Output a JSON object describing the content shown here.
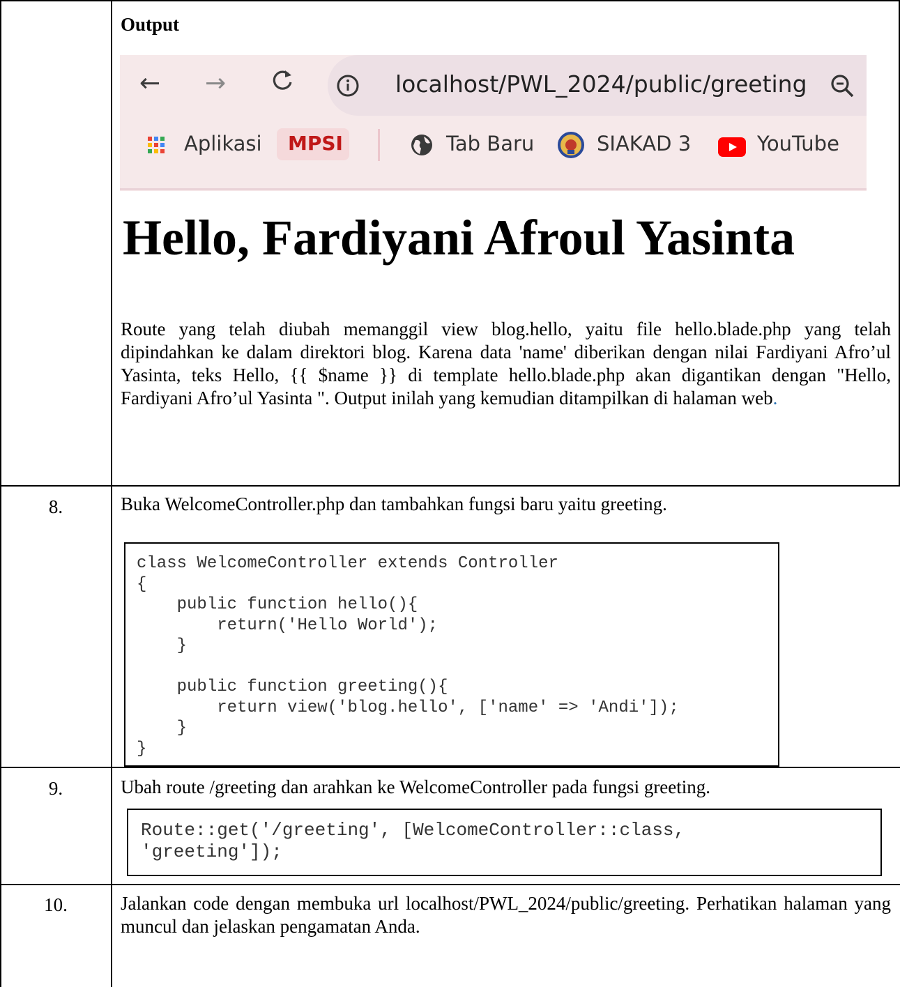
{
  "row7": {
    "heading": "Output",
    "browser": {
      "url": "localhost/PWL_2024/public/greeting",
      "nav_icons": [
        "back-arrow-icon",
        "forward-arrow-icon",
        "reload-icon",
        "info-icon",
        "zoom-icon"
      ],
      "bookmarks": [
        {
          "label": "Aplikasi",
          "icon": "apps-grid-icon"
        },
        {
          "label": "MPSI",
          "icon": ""
        },
        {
          "label": "Tab Baru",
          "icon": "globe-icon"
        },
        {
          "label": "SIAKAD 3",
          "icon": "siakad-emblem-icon"
        },
        {
          "label": "YouTube",
          "icon": "youtube-icon"
        }
      ],
      "page_heading": "Hello, Fardiyani Afroul Yasinta"
    },
    "explanation": "Route yang telah diubah memanggil view blog.hello, yaitu file hello.blade.php yang telah dipindahkan ke dalam direktori blog. Karena data 'name' diberikan dengan nilai Fardiyani Afro’ul Yasinta, teks Hello, {{ $name }} di template hello.blade.php akan digantikan dengan \"Hello, Fardiyani Afro’ul Yasinta \". Output inilah yang kemudian ditampilkan di halaman web",
    "explanation_end": "."
  },
  "row8": {
    "number": "8.",
    "instruction": "Buka WelcomeController.php dan tambahkan fungsi baru yaitu greeting.",
    "code": "class WelcomeController extends Controller\n{\n    public function hello(){\n        return('Hello World');\n    }\n\n    public function greeting(){\n        return view('blog.hello', ['name' => 'Andi']);\n    }\n}"
  },
  "row9": {
    "number": "9.",
    "instruction": "Ubah route /greeting dan arahkan ke WelcomeController pada fungsi greeting.",
    "code": "Route::get('/greeting', [WelcomeController::class,\n'greeting']);"
  },
  "row10": {
    "number": "10.",
    "instruction": "Jalankan code dengan membuka url localhost/PWL_2024/public/greeting. Perhatikan halaman yang muncul dan jelaskan pengamatan Anda."
  }
}
